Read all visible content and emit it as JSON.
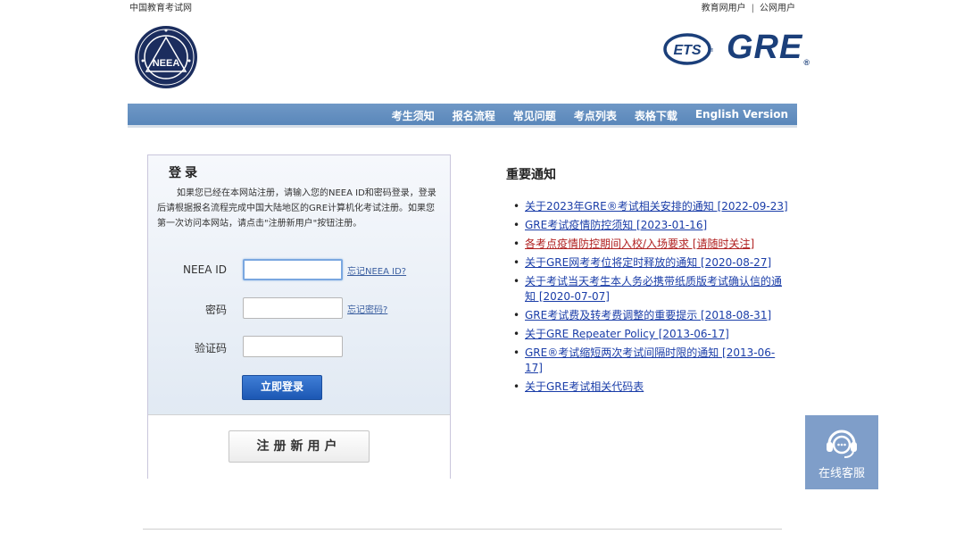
{
  "top": {
    "site_name": "中国教育考试网",
    "user_links": [
      "教育网用户",
      "公网用户"
    ]
  },
  "logos": {
    "neea": "NEEA",
    "ets": "ETS",
    "gre": "GRE"
  },
  "nav": {
    "items": [
      "考生须知",
      "报名流程",
      "常见问题",
      "考点列表",
      "表格下载",
      "English Version"
    ]
  },
  "login": {
    "title": "登录",
    "description": "如果您已经在本网站注册，请输入您的NEEA ID和密码登录，登录后请根据报名流程完成中国大陆地区的GRE计算机化考试注册。如果您第一次访问本网站，请点击\"注册新用户\"按钮注册。",
    "fields": [
      {
        "label": "NEEA ID",
        "value": "",
        "link": "忘记NEEA ID?"
      },
      {
        "label": "密码",
        "value": "",
        "link": "忘记密码?"
      },
      {
        "label": "验证码",
        "value": "",
        "link": ""
      }
    ],
    "submit_label": "立即登录",
    "register_label": "注册新用户"
  },
  "notices": {
    "title": "重要通知",
    "items": [
      {
        "text": "关于2023年GRE®考试相关安排的通知 [2022-09-23]",
        "highlight": false
      },
      {
        "text": "GRE考试疫情防控须知 [2023-01-16]",
        "highlight": false
      },
      {
        "text": "各考点疫情防控期间入校/入场要求 [请随时关注]",
        "highlight": true
      },
      {
        "text": "关于GRE网考考位将定时释放的通知 [2020-08-27]",
        "highlight": false
      },
      {
        "text": "关于考试当天考生本人务必携带纸质版考试确认信的通知 [2020-07-07]",
        "highlight": false
      },
      {
        "text": "GRE考试费及转考费调整的重要提示 [2018-08-31]",
        "highlight": false
      },
      {
        "text": "关于GRE Repeater Policy [2013-06-17]",
        "highlight": false
      },
      {
        "text": "GRE®考试缩短两次考试间隔时限的通知 [2013-06-17]",
        "highlight": false
      },
      {
        "text": "关于GRE考试相关代码表",
        "highlight": false
      }
    ]
  },
  "chat": {
    "label": "在线客服",
    "icon": "headset-icon"
  },
  "colors": {
    "nav_bg": "#5a87ba",
    "link_blue": "#1a3da8",
    "link_red": "#b02020",
    "login_btn": "#1c57b3",
    "chat_bg": "#7f9ec9",
    "gre_blue": "#1b3f7a"
  }
}
